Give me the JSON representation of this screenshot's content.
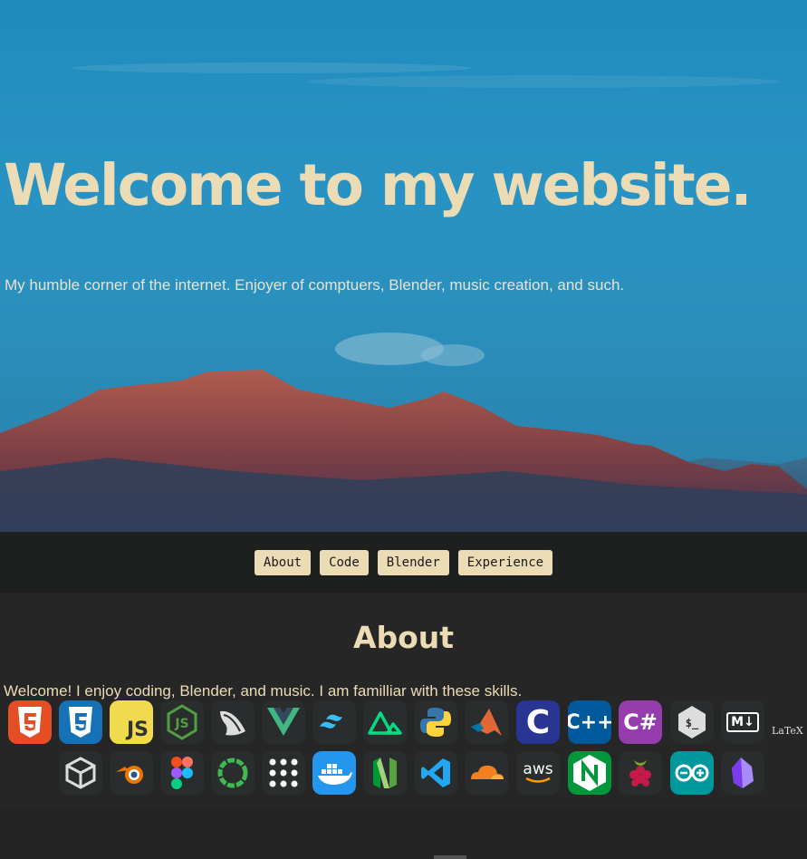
{
  "hero": {
    "title": "Welcome to my website.",
    "subtitle": "My humble corner of the internet. Enjoyer of comptuers, Blender, music creation, and such."
  },
  "nav": {
    "items": [
      {
        "label": "About"
      },
      {
        "label": "Code"
      },
      {
        "label": "Blender"
      },
      {
        "label": "Experience"
      }
    ]
  },
  "about": {
    "heading": "About",
    "text": "Welcome! I enjoy coding, Blender, and music. I am familliar with these skills."
  },
  "skills": {
    "row1": [
      "html5-icon",
      "css3-icon",
      "javascript-icon",
      "nodejs-icon",
      "flask-icon",
      "vue-icon",
      "tailwind-icon",
      "nuxt-icon",
      "python-icon",
      "matlab-icon",
      "c-icon",
      "cplusplus-icon",
      "csharp-icon",
      "bash-icon",
      "markdown-icon",
      "latex-icon"
    ],
    "row2": [
      "unity-icon",
      "blender-icon",
      "figma-icon",
      "circleci-icon",
      "dots-grid-icon",
      "docker-icon",
      "neovim-icon",
      "vscode-icon",
      "cloudflare-icon",
      "aws-icon",
      "nginx-icon",
      "raspberry-pi-icon",
      "arduino-icon",
      "obsidian-icon"
    ],
    "glyphs": {
      "js": "JS",
      "aws": "aws",
      "markdown": "M↓",
      "latex": "LaTeX",
      "bash": "$_",
      "c": "C",
      "cpp": "C++",
      "csharp": "C#"
    }
  },
  "colors": {
    "accent": "#ecdcb5",
    "nav_bg": "#1e1f1f",
    "page_bg": "#262626"
  }
}
